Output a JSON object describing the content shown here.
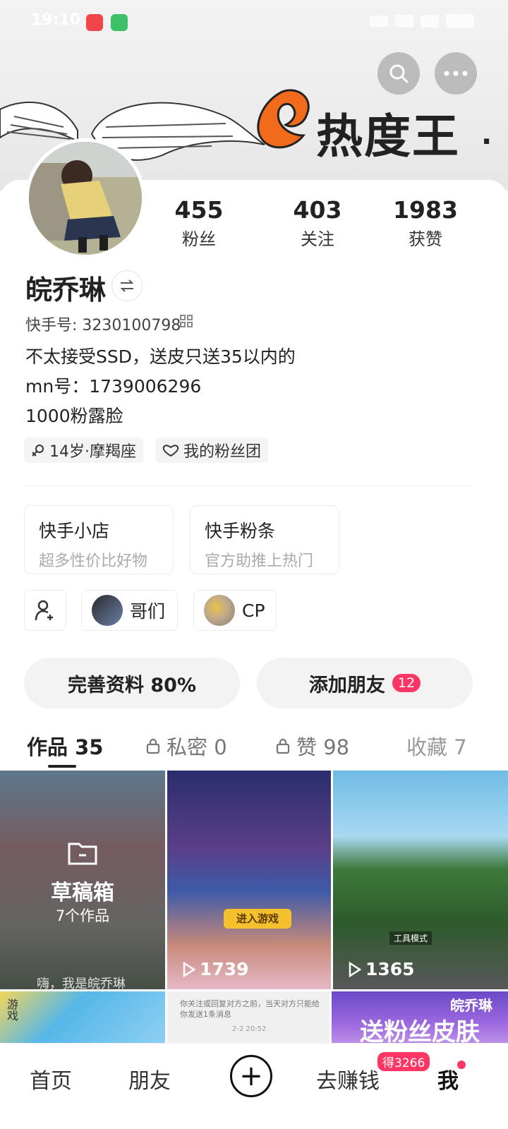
{
  "status_bar": {
    "time": "19:10"
  },
  "banner": {
    "text": "热度王",
    "dot": "."
  },
  "stats": [
    {
      "num": "455",
      "label": "粉丝"
    },
    {
      "num": "403",
      "label": "关注"
    },
    {
      "num": "1983",
      "label": "获赞"
    }
  ],
  "profile": {
    "name": "皖乔琳",
    "kuaishou_id": "快手号: 3230100798",
    "bio": [
      "不太接受SSD，送皮只送35以内的",
      "mn号：1739006296",
      "1000粉露脸"
    ],
    "tags": [
      "14岁·摩羯座",
      "我的粉丝团"
    ]
  },
  "shops": [
    {
      "title": "快手小店",
      "sub": "超多性价比好物"
    },
    {
      "title": "快手粉条",
      "sub": "官方助推上热门"
    }
  ],
  "chips": [
    "哥们",
    "CP"
  ],
  "actions": {
    "complete": "完善资料 80%",
    "add_friend": "添加朋友",
    "add_friend_badge": "12"
  },
  "tabs": [
    {
      "label": "作品 35"
    },
    {
      "label": "私密 0"
    },
    {
      "label": "赞 98"
    },
    {
      "label": "收藏 7"
    }
  ],
  "grid": {
    "draft_title": "草稿箱",
    "draft_count": "7个作品",
    "draft_overlay_text": "嗨，我是皖乔琳",
    "tile2_button": "进入游戏",
    "tile2_views": "1739",
    "tile3_sign": "工具模式",
    "tile3_views": "1365",
    "tile4_side": "游戏",
    "tile5_text": "你关注或回复对方之前，当天对方只能给你发送1条消息",
    "tile5_time": "2-2 20:52",
    "tile6_name": "皖乔琳",
    "tile6_text": "送粉丝皮肤"
  },
  "nav": {
    "home": "首页",
    "friends": "朋友",
    "earn": "去赚钱",
    "earn_badge": "得3266",
    "me": "我"
  }
}
